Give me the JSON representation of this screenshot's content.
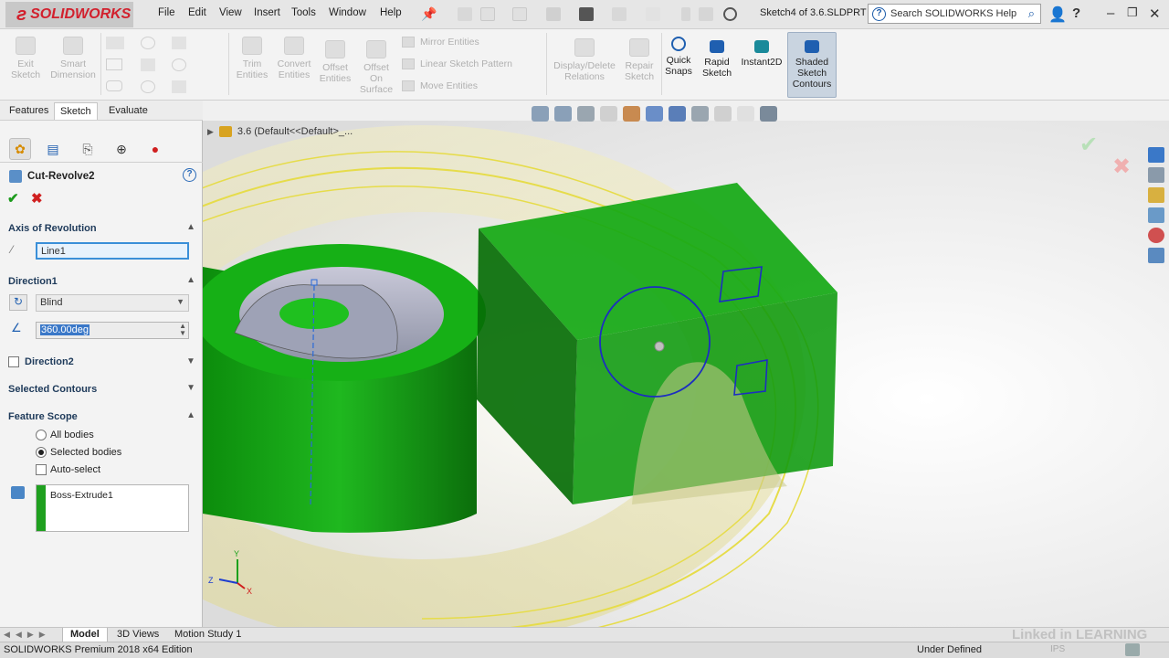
{
  "app": {
    "brand": "SOLIDWORKS",
    "edition": "SOLIDWORKS Premium 2018 x64 Edition"
  },
  "menu": [
    "File",
    "Edit",
    "View",
    "Insert",
    "Tools",
    "Window",
    "Help"
  ],
  "document_title": "Sketch4 of 3.6.SLDPRT *",
  "search": {
    "placeholder": "Search SOLIDWORKS Help"
  },
  "commands": {
    "exit_sketch": "Exit Sketch",
    "smart_dimension": "Smart Dimension",
    "trim_entities": "Trim Entities",
    "convert_entities": "Convert Entities",
    "offset_entities": "Offset Entities",
    "offset_on_surface": "Offset On Surface",
    "mirror_entities": "Mirror Entities",
    "linear_sketch_pattern": "Linear Sketch Pattern",
    "move_entities": "Move Entities",
    "display_delete_relations": "Display/Delete Relations",
    "repair_sketch": "Repair Sketch",
    "quick_snaps": "Quick Snaps",
    "rapid_sketch": "Rapid Sketch",
    "instant2d": "Instant2D",
    "shaded_sketch_contours": "Shaded Sketch Contours"
  },
  "cm_tabs": [
    "Features",
    "Sketch",
    "Evaluate"
  ],
  "property_manager": {
    "title": "Cut-Revolve2",
    "axis_group": "Axis of Revolution",
    "axis_value": "Line1",
    "direction1_group": "Direction1",
    "end_condition": "Blind",
    "angle": "360.00deg",
    "direction2": "Direction2",
    "selected_contours": "Selected Contours",
    "feature_scope": "Feature Scope",
    "scope_options": [
      "All bodies",
      "Selected bodies"
    ],
    "auto_select": "Auto-select",
    "bodies": [
      "Boss-Extrude1"
    ]
  },
  "viewport": {
    "breadcrumb": "3.6  (Default<<Default>_..."
  },
  "triad": {
    "x": "Z",
    "y": "Y",
    "z": "X"
  },
  "bottom_tabs": [
    "Model",
    "3D Views",
    "Motion Study 1"
  ],
  "status": {
    "definition": "Under Defined",
    "units": "IPS"
  },
  "watermark": "Linked in LEARNING",
  "colors": {
    "accent_blue": "#1f5fb0",
    "body_green": "#14a014",
    "ok_green": "#1b9a1b",
    "cancel_red": "#d02020",
    "selection_yellow": "#e8e070"
  }
}
